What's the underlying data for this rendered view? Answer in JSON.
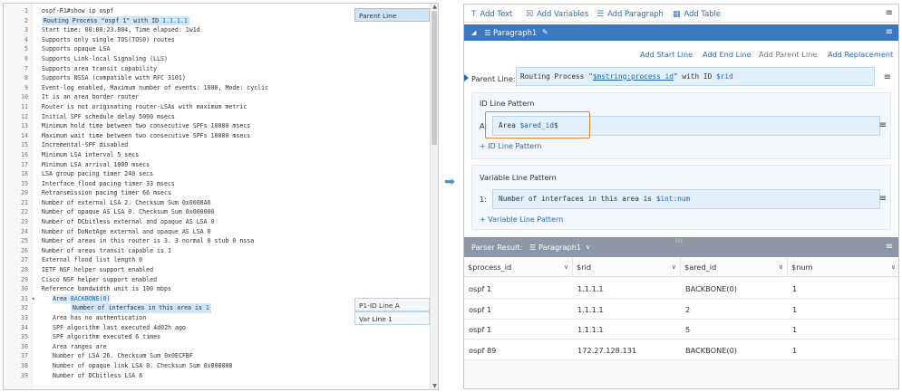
{
  "editor": {
    "lines": [
      {
        "n": "1",
        "parts": [
          {
            "t": "ospf-R1#show ip ospf"
          }
        ]
      },
      {
        "n": "2",
        "hl": true,
        "parts": [
          {
            "t": "Routing Process \"ospf 1\" with ID "
          },
          {
            "t": "1.1.1.1",
            "v": true
          }
        ]
      },
      {
        "n": "3",
        "parts": [
          {
            "t": "Start time: 00:00:23.804, Time elapsed: 1w1d"
          }
        ]
      },
      {
        "n": "4",
        "parts": [
          {
            "t": "Supports only single TOS(TOS0) routes"
          }
        ]
      },
      {
        "n": "5",
        "parts": [
          {
            "t": "Supports opaque LSA"
          }
        ]
      },
      {
        "n": "6",
        "parts": [
          {
            "t": "Supports Link-local Signaling (LLS)"
          }
        ]
      },
      {
        "n": "7",
        "parts": [
          {
            "t": "Supports area transit capability"
          }
        ]
      },
      {
        "n": "8",
        "parts": [
          {
            "t": "Supports NSSA (compatible with RFC 3101)"
          }
        ]
      },
      {
        "n": "9",
        "parts": [
          {
            "t": "Event-log enabled, Maximum number of events: 1000, Mode: cyclic"
          }
        ]
      },
      {
        "n": "10",
        "parts": [
          {
            "t": "It is an area border router"
          }
        ]
      },
      {
        "n": "11",
        "parts": [
          {
            "t": "Router is not originating router-LSAs with maximum metric"
          }
        ]
      },
      {
        "n": "12",
        "parts": [
          {
            "t": "Initial SPF schedule delay 5000 msecs"
          }
        ]
      },
      {
        "n": "13",
        "parts": [
          {
            "t": "Minimum hold time between two consecutive SPFs 10000 msecs"
          }
        ]
      },
      {
        "n": "14",
        "parts": [
          {
            "t": "Maximum wait time between two consecutive SPFs 10000 msecs"
          }
        ]
      },
      {
        "n": "15",
        "parts": [
          {
            "t": "Incremental-SPF disabled"
          }
        ]
      },
      {
        "n": "16",
        "parts": [
          {
            "t": "Minimum LSA interval 5 secs"
          }
        ]
      },
      {
        "n": "17",
        "parts": [
          {
            "t": "Minimum LSA arrival 1000 msecs"
          }
        ]
      },
      {
        "n": "18",
        "parts": [
          {
            "t": "LSA group pacing timer 240 secs"
          }
        ]
      },
      {
        "n": "19",
        "parts": [
          {
            "t": "Interface flood pacing timer 33 msecs"
          }
        ]
      },
      {
        "n": "20",
        "parts": [
          {
            "t": "Retransmission pacing timer 66 msecs"
          }
        ]
      },
      {
        "n": "21",
        "parts": [
          {
            "t": "Number of external LSA 2. Checksum Sum 0x0008A6"
          }
        ]
      },
      {
        "n": "22",
        "parts": [
          {
            "t": "Number of opaque AS LSA 0. Checksum Sum 0x000000"
          }
        ]
      },
      {
        "n": "23",
        "parts": [
          {
            "t": "Number of DCbitless external and opaque AS LSA 0"
          }
        ]
      },
      {
        "n": "24",
        "parts": [
          {
            "t": "Number of DoNotAge external and opaque AS LSA 0"
          }
        ]
      },
      {
        "n": "25",
        "parts": [
          {
            "t": "Number of areas in this router is 3. 3 normal 0 stub 0 nssa"
          }
        ]
      },
      {
        "n": "26",
        "parts": [
          {
            "t": "Number of areas transit capable is 1"
          }
        ]
      },
      {
        "n": "27",
        "parts": [
          {
            "t": "External flood list length 0"
          }
        ]
      },
      {
        "n": "28",
        "parts": [
          {
            "t": "IETF NSF helper support enabled"
          }
        ]
      },
      {
        "n": "29",
        "parts": [
          {
            "t": "Cisco NSF helper support enabled"
          }
        ]
      },
      {
        "n": "30",
        "parts": [
          {
            "t": "Reference bandwidth unit is 100 mbps"
          }
        ]
      },
      {
        "n": "31",
        "fold": "▴",
        "indent": 1,
        "hl2": true,
        "parts": [
          {
            "t": "Area "
          },
          {
            "t": "BACKBONE(0)",
            "v": true
          }
        ]
      },
      {
        "n": "32",
        "indent": 2,
        "hl": true,
        "parts": [
          {
            "t": "Number of interfaces in this area is "
          },
          {
            "t": "1",
            "v": true
          }
        ]
      },
      {
        "n": "33",
        "indent": 1,
        "parts": [
          {
            "t": "Area has no authentication"
          }
        ]
      },
      {
        "n": "34",
        "indent": 1,
        "parts": [
          {
            "t": "SPF algorithm last executed 4d02h ago"
          }
        ]
      },
      {
        "n": "35",
        "indent": 1,
        "parts": [
          {
            "t": "SPF algorithm executed 6 times"
          }
        ]
      },
      {
        "n": "36",
        "indent": 1,
        "parts": [
          {
            "t": "Area ranges are"
          }
        ]
      },
      {
        "n": "37",
        "indent": 1,
        "parts": [
          {
            "t": "Number of LSA 26. Checksum Sum 0x0ECFBF"
          }
        ]
      },
      {
        "n": "38",
        "indent": 1,
        "parts": [
          {
            "t": "Number of opaque link LSA 0. Checksum Sum 0x000000"
          }
        ]
      },
      {
        "n": "39",
        "indent": 1,
        "parts": [
          {
            "t": "Number of DCbitless LSA 6"
          }
        ]
      }
    ],
    "tags": {
      "parent_line": "Parent Line",
      "id_line": "P1-ID Line A",
      "var_line": "Var Line 1"
    }
  },
  "toolbar": {
    "add_text": "Add Text",
    "add_variables": "Add Variables",
    "add_paragraph": "Add Paragraph",
    "add_table": "Add Table"
  },
  "paragraph": {
    "name": "Paragraph1",
    "links": {
      "add_start_line": "Add Start Line",
      "add_end_line": "Add End Line",
      "add_parent_line": "Add Parent Line",
      "add_replacement": "Add Replacement"
    },
    "parent_line_label": "Parent Line:",
    "parent_line_parts": [
      {
        "t": "Routing Process \""
      },
      {
        "t": "$mstring:process_id",
        "v": true,
        "u": true
      },
      {
        "t": "\" with ID "
      },
      {
        "t": "$rid",
        "v": true
      }
    ],
    "id_group": {
      "title": "ID Line Pattern",
      "prefix": "A:",
      "parts": [
        {
          "t": "Area "
        },
        {
          "t": "$ared_id",
          "v": true
        },
        {
          "t": "$"
        }
      ],
      "add": "+ ID Line Pattern"
    },
    "var_group": {
      "title": "Variable Line Pattern",
      "prefix": "1:",
      "parts": [
        {
          "t": "Number of interfaces in this area is "
        },
        {
          "t": "$int:num",
          "v": true
        }
      ],
      "add": "+ Variable Line Pattern"
    }
  },
  "parser_result": {
    "label": "Parser Result:",
    "paragraph": "Paragraph1",
    "columns": [
      "$process_id",
      "$rid",
      "$ared_id",
      "$num"
    ],
    "rows": [
      [
        "ospf 1",
        "1.1.1.1",
        "BACKBONE(0)",
        "1"
      ],
      [
        "ospf 1",
        "1.1.1.1",
        "2",
        "1"
      ],
      [
        "ospf 1",
        "1.1.1.1",
        "5",
        "1"
      ],
      [
        "ospf 89",
        "172.27.128.131",
        "BACKBONE(0)",
        "1"
      ]
    ]
  },
  "icons": [
    "text-icon",
    "variables-icon",
    "paragraph-icon",
    "table-icon",
    "menu-icon",
    "edit-icon",
    "chevron-down-icon",
    "arrow-right-icon"
  ],
  "colors": {
    "accent": "#3a78c2",
    "variable": "#1565c0",
    "highlight": "#cfe6f9",
    "result_header": "#8c98a6",
    "focus_border": "#e0863a"
  }
}
